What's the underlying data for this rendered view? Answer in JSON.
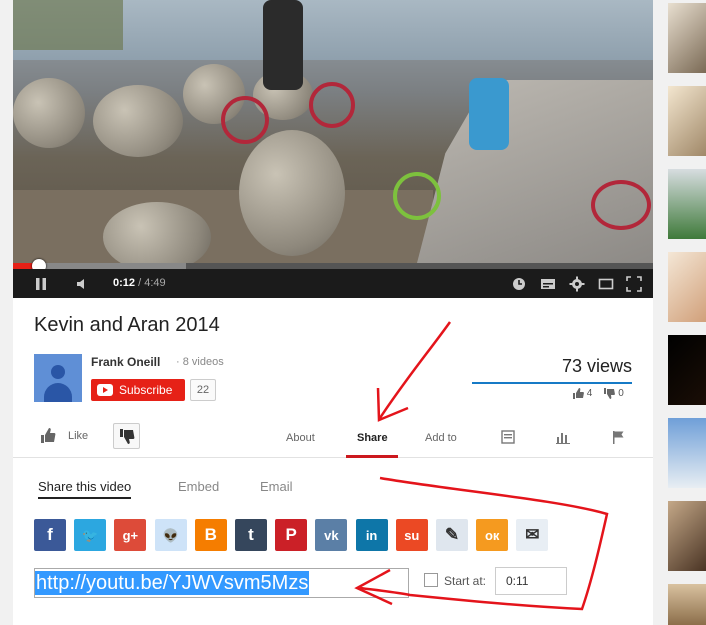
{
  "player": {
    "time_current": "0:12",
    "time_separator": " / ",
    "time_total": "4:49",
    "progress_played": 0.041,
    "progress_buffered": 0.27
  },
  "video": {
    "title": "Kevin and Aran 2014",
    "channel_name": "Frank Oneill",
    "video_count": "8 videos",
    "subscribe_label": "Subscribe",
    "subscriber_count": "22",
    "views": "73 views",
    "likes": "4",
    "dislikes": "0"
  },
  "actions": {
    "like_label": "Like",
    "tabs": [
      "About",
      "Share",
      "Add to"
    ]
  },
  "share": {
    "tabs": [
      "Share this video",
      "Embed",
      "Email"
    ],
    "url": "http://youtu.be/YJWVsvm5Mzs",
    "start_at_label": "Start at:",
    "start_at_value": "0:11",
    "networks": [
      {
        "icon": "facebook-icon",
        "glyph": "f",
        "color": "#3b5998"
      },
      {
        "icon": "twitter-icon",
        "glyph": "🐦",
        "color": "#2ca7e0"
      },
      {
        "icon": "google-plus-icon",
        "glyph": "g+",
        "color": "#dd4b39"
      },
      {
        "icon": "reddit-icon",
        "glyph": "👽",
        "color": "#cee3f8"
      },
      {
        "icon": "blogger-icon",
        "glyph": "B",
        "color": "#f57d00"
      },
      {
        "icon": "tumblr-icon",
        "glyph": "t",
        "color": "#35465c"
      },
      {
        "icon": "pinterest-icon",
        "glyph": "P",
        "color": "#cb2027"
      },
      {
        "icon": "vk-icon",
        "glyph": "vk",
        "color": "#5b7fa6"
      },
      {
        "icon": "linkedin-icon",
        "glyph": "in",
        "color": "#0e76a8"
      },
      {
        "icon": "stumbleupon-icon",
        "glyph": "su",
        "color": "#eb4924"
      },
      {
        "icon": "livejournal-icon",
        "glyph": "✎",
        "color": "#dfe6ee"
      },
      {
        "icon": "odnoklassniki-icon",
        "glyph": "ок",
        "color": "#f59a1f"
      },
      {
        "icon": "mixi-icon",
        "glyph": "✉",
        "color": "#e8eef4"
      }
    ]
  },
  "colors": {
    "accent_red": "#e62117",
    "annotation_red": "#e4141b",
    "link_blue": "#167ac6"
  }
}
